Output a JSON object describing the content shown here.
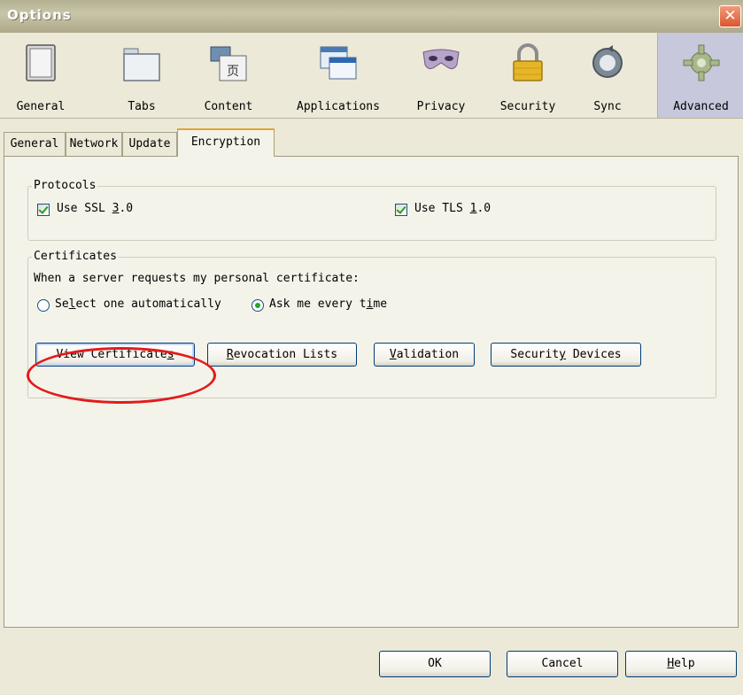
{
  "window": {
    "title": "Options",
    "close_label": "✕"
  },
  "toolbar": {
    "items": [
      {
        "label": "General",
        "icon": "general-icon"
      },
      {
        "label": "Tabs",
        "icon": "tabs-icon"
      },
      {
        "label": "Content",
        "icon": "content-icon"
      },
      {
        "label": "Applications",
        "icon": "applications-icon"
      },
      {
        "label": "Privacy",
        "icon": "privacy-mask-icon"
      },
      {
        "label": "Security",
        "icon": "padlock-icon"
      },
      {
        "label": "Sync",
        "icon": "sync-icon"
      },
      {
        "label": "Advanced",
        "icon": "gear-icon",
        "active": true
      }
    ]
  },
  "subtabs": [
    {
      "label": "General"
    },
    {
      "label": "Network"
    },
    {
      "label": "Update"
    },
    {
      "label": "Encryption",
      "active": true
    }
  ],
  "protocols": {
    "legend": "Protocols",
    "ssl_pre": "Use SSL ",
    "ssl_key": "3",
    "ssl_post": ".0",
    "tls_pre": "Use TLS ",
    "tls_key": "1",
    "tls_post": ".0",
    "ssl_checked": true,
    "tls_checked": true
  },
  "certificates": {
    "legend": "Certificates",
    "prompt": "When a server requests my personal certificate:",
    "auto_pre": "Se",
    "auto_key": "l",
    "auto_post": "ect one automatically",
    "ask_pre": "Ask me every t",
    "ask_key": "i",
    "ask_post": "me",
    "selected": "ask"
  },
  "cert_buttons": {
    "view_pre": "View Certificate",
    "view_key": "s",
    "revocation_key": "R",
    "revocation_post": "evocation Lists",
    "validation_key": "V",
    "validation_post": "alidation",
    "devices_pre": "Securit",
    "devices_key": "y",
    "devices_post": " Devices"
  },
  "footer": {
    "ok": "OK",
    "cancel": "Cancel",
    "help_key": "H",
    "help_post": "elp"
  },
  "colors": {
    "annotation": "#e21b1b",
    "active_tab_accent": "#e3a430",
    "check": "#21a121"
  }
}
